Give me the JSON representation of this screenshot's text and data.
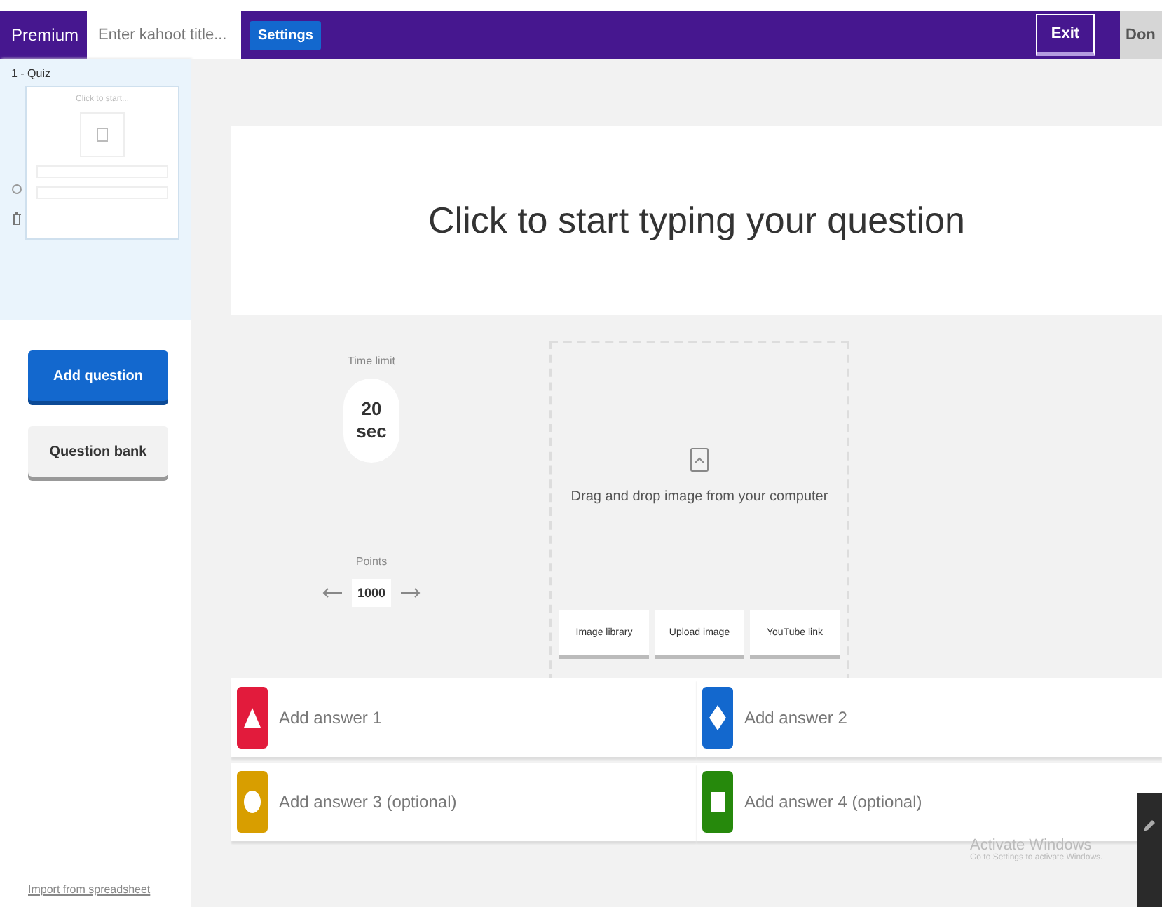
{
  "top_bar": {
    "plan_label": "Premium",
    "title_field": {
      "placeholder": "Enter kahoot title..."
    },
    "settings_button": "Settings",
    "exit_button": "Exit",
    "done_button": "Don"
  },
  "sidebar": {
    "slides": [
      {
        "label": "1 - Quiz",
        "thumbnail_text": "Click to start...",
        "selected": true
      }
    ],
    "add_button": "Add question",
    "bank_button": "Question bank",
    "import_link": "Import from spreadsheet"
  },
  "question": {
    "placeholder": "Click to start typing your question"
  },
  "time_limit": {
    "label": "Time limit",
    "value": "20",
    "unit": "sec"
  },
  "points": {
    "label": "Points",
    "value": "1000"
  },
  "media": {
    "hint": "Drag and drop image from your computer",
    "buttons": [
      "Image library",
      "Upload image",
      "YouTube link"
    ]
  },
  "answers": [
    {
      "placeholder": "Add answer 1",
      "kind": "triangle",
      "color": "#e21b3c"
    },
    {
      "placeholder": "Add answer 2",
      "kind": "diamond",
      "color": "#1368ce"
    },
    {
      "placeholder": "Add answer 3 (optional)",
      "kind": "circle",
      "color": "#d89e00"
    },
    {
      "placeholder": "Add answer 4 (optional)",
      "kind": "square",
      "color": "#26890c"
    }
  ],
  "overlay": {
    "title": "Activate Windows",
    "text": "Go to Settings to activate Windows."
  }
}
